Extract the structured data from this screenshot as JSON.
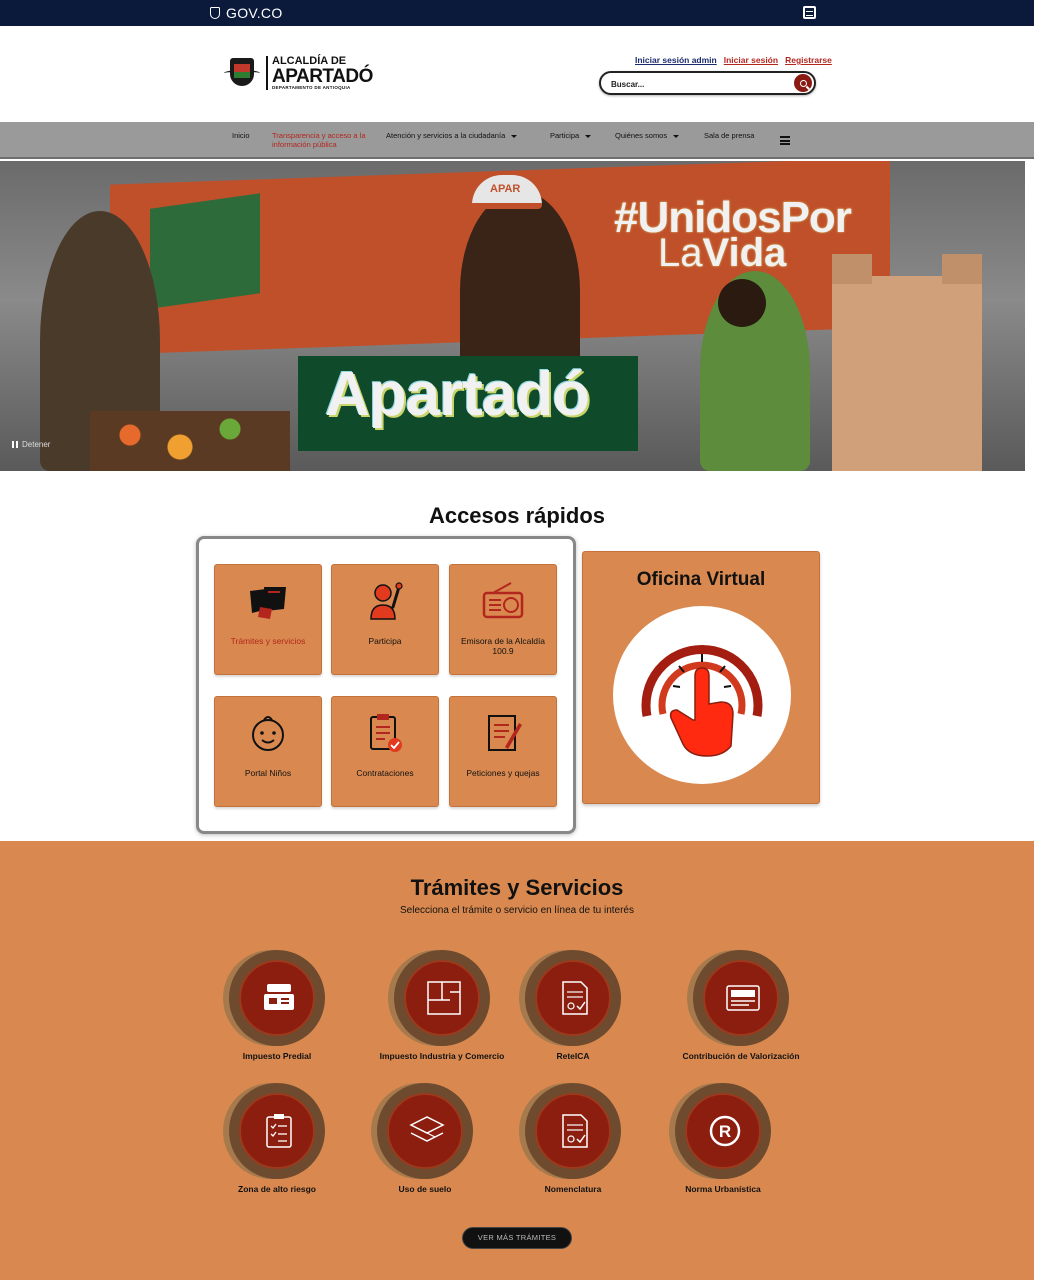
{
  "govbar": {
    "brand": "GOV.CO"
  },
  "header": {
    "logo": {
      "line1": "ALCALDÍA DE",
      "line2": "APARTADÓ",
      "line3": "DEPARTAMENTO DE ANTIOQUIA"
    },
    "links": {
      "admin": "Iniciar sesión admin",
      "login": "Iniciar sesión",
      "register": "Registrarse"
    },
    "search": {
      "placeholder": "Buscar..."
    }
  },
  "nav": {
    "items": [
      {
        "label": "Inicio"
      },
      {
        "label": "Transparencia y acceso a la información pública"
      },
      {
        "label": "Atención y servicios a la ciudadanía"
      },
      {
        "label": "Participa"
      },
      {
        "label": "Quiénes somos"
      },
      {
        "label": "Sala de prensa"
      }
    ]
  },
  "hero": {
    "hashtag_line1": "#UnidosPor",
    "hashtag_line2a": "La",
    "hashtag_line2b": "Vida",
    "city": "Apartadó",
    "cap_text": "APAR",
    "pause_label": "Detener"
  },
  "quick_access": {
    "title": "Accesos rápidos",
    "cards": [
      {
        "label": "Trámites y servicios"
      },
      {
        "label": "Participa"
      },
      {
        "label": "Emisora de la Alcaldía 100.9"
      },
      {
        "label": "Portal Niños"
      },
      {
        "label": "Contrataciones"
      },
      {
        "label": "Peticiones y quejas"
      }
    ],
    "virtual_office": {
      "title": "Oficina Virtual"
    }
  },
  "tramites": {
    "title": "Trámites y Servicios",
    "subtitle": "Selecciona el trámite o servicio en línea de tu interés",
    "services": [
      {
        "label": "Impuesto Predial"
      },
      {
        "label": "Impuesto Industria y Comercio"
      },
      {
        "label": "ReteICA"
      },
      {
        "label": "Contribución de Valorización"
      },
      {
        "label": "Zona de alto riesgo"
      },
      {
        "label": "Uso de suelo"
      },
      {
        "label": "Nomenclatura"
      },
      {
        "label": "Norma Urbanística"
      }
    ],
    "more_button": "VER MÁS TRÁMITES"
  },
  "colors": {
    "accent": "#d9894f",
    "brand_red": "#8c1e10",
    "govbar": "#0b1a3a",
    "nav": "#9a9a9a"
  }
}
